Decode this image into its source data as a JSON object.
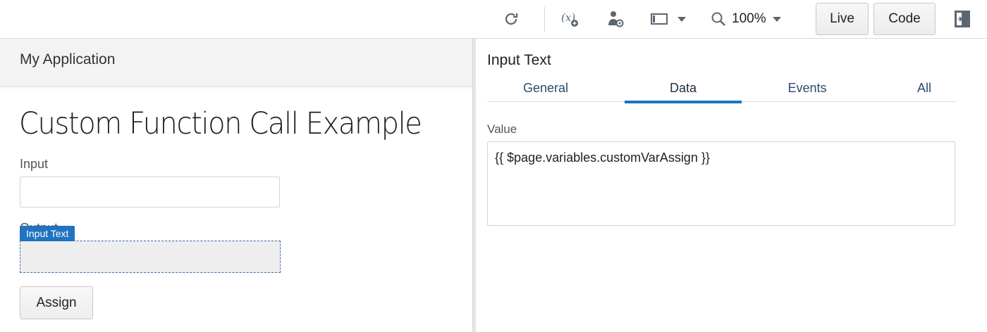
{
  "toolbar": {
    "icons": [
      "refresh-icon",
      "variable-icon",
      "user-settings-icon",
      "device-frame-icon",
      "zoom-icon",
      "panel-toggle-icon"
    ],
    "zoom_level": "100%",
    "live_label": "Live",
    "code_label": "Code"
  },
  "canvas": {
    "app_title": "My Application",
    "page_heading": "Custom Function Call Example",
    "input_label": "Input",
    "output_label": "Output",
    "selection_tag": "Input Text",
    "assign_label": "Assign"
  },
  "panel": {
    "title": "Input Text",
    "tabs": [
      {
        "label": "General",
        "active": false
      },
      {
        "label": "Data",
        "active": true
      },
      {
        "label": "Events",
        "active": false
      },
      {
        "label": "All",
        "active": false
      }
    ],
    "value_label": "Value",
    "value_text": "{{ $page.variables.customVarAssign }}"
  },
  "colors": {
    "accent": "#1f73c2",
    "header_bg": "#f3f3f3",
    "output_bg": "#eeeeee"
  }
}
